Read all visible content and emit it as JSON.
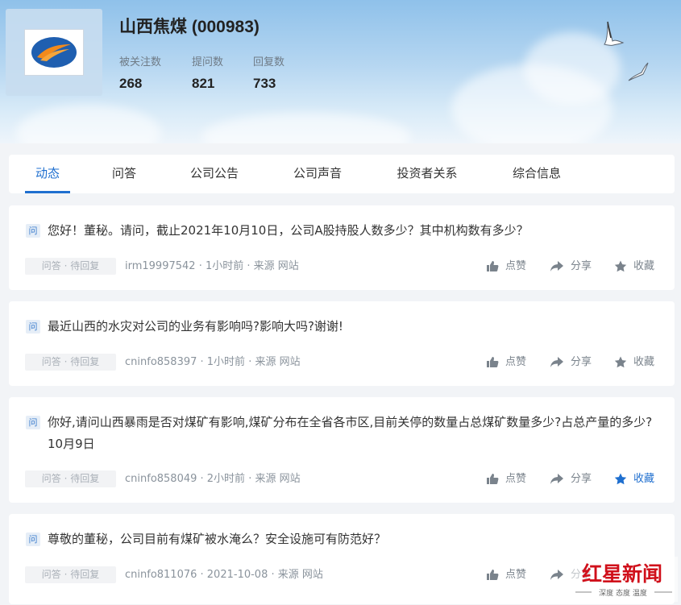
{
  "company": {
    "name": "山西焦煤 (000983)",
    "stats": [
      {
        "label": "被关注数",
        "value": "268"
      },
      {
        "label": "提问数",
        "value": "821"
      },
      {
        "label": "回复数",
        "value": "733"
      }
    ]
  },
  "tabs": [
    {
      "label": "动态",
      "active": true
    },
    {
      "label": "问答"
    },
    {
      "label": "公司公告"
    },
    {
      "label": "公司声音"
    },
    {
      "label": "投资者关系"
    },
    {
      "label": "综合信息"
    }
  ],
  "question_badge": "问",
  "actions": {
    "like": "点赞",
    "share": "分享",
    "favorite": "收藏"
  },
  "questions": [
    {
      "text": "您好！董秘。请问，截止2021年10月10日，公司A股持股人数多少？其中机构数有多少？",
      "status": "问答 · 待回复",
      "meta": "irm19997542 · 1小时前 · 来源 网站",
      "favorited": false
    },
    {
      "text": "最近山西的水灾对公司的业务有影响吗?影响大吗?谢谢!",
      "status": "问答 · 待回复",
      "meta": "cninfo858397 · 1小时前 · 来源 网站",
      "favorited": false
    },
    {
      "text": "你好,请问山西暴雨是否对煤矿有影响,煤矿分布在全省各市区,目前关停的数量占总煤矿数量多少?占总产量的多少? 10月9日",
      "status": "问答 · 待回复",
      "meta": "cninfo858049 · 2小时前 · 来源 网站",
      "favorited": true
    },
    {
      "text": "尊敬的董秘，公司目前有煤矿被水淹么？安全设施可有防范好？",
      "status": "问答 · 待回复",
      "meta": "cninfo811076 · 2021-10-08 · 来源 网站",
      "favorited": false
    }
  ],
  "watermark": {
    "title": "红星新闻",
    "subtitle": "深度 态度 温度"
  },
  "colors": {
    "accent": "#1f6fcf",
    "favorited": "#1f6fcf",
    "icon": "#7a838c"
  }
}
